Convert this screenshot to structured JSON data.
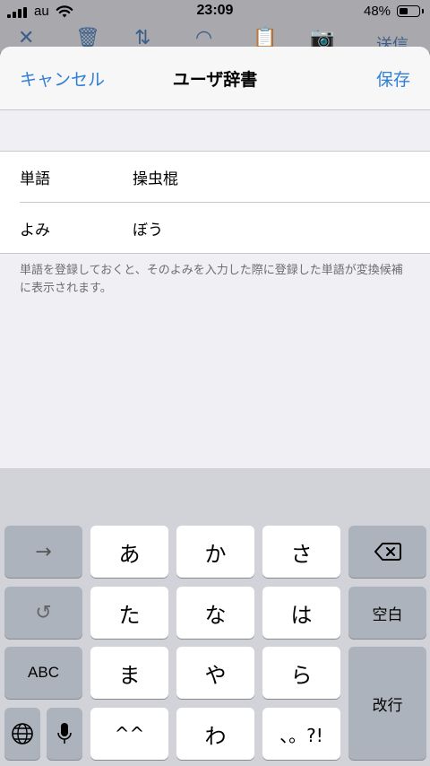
{
  "status_bar": {
    "carrier": "au",
    "time": "23:09",
    "battery_percent": "48%",
    "battery_level": 0.48
  },
  "background_toolbar": {
    "icons": [
      "close-icon",
      "trash-icon",
      "move-icon",
      "pin-icon",
      "clipboard-icon",
      "camera-icon"
    ],
    "send_label": "送信"
  },
  "nav": {
    "cancel": "キャンセル",
    "title": "ユーザ辞書",
    "save": "保存"
  },
  "form": {
    "word_label": "単語",
    "word_value": "操虫棍",
    "reading_label": "よみ",
    "reading_value": "ぼう"
  },
  "footnote": "単語を登録しておくと、そのよみを入力した際に登録した単語が変換候補に表示されます。",
  "keyboard": {
    "arrow": "→",
    "undo": "↺",
    "abc": "ABC",
    "globe_icon": "globe-icon",
    "mic_icon": "microphone-icon",
    "keys": [
      "あ",
      "か",
      "さ",
      "た",
      "な",
      "は",
      "ま",
      "や",
      "ら",
      "^^",
      "わ",
      "、。?!"
    ],
    "delete_icon": "backspace-icon",
    "space": "空白",
    "return": "改行"
  }
}
